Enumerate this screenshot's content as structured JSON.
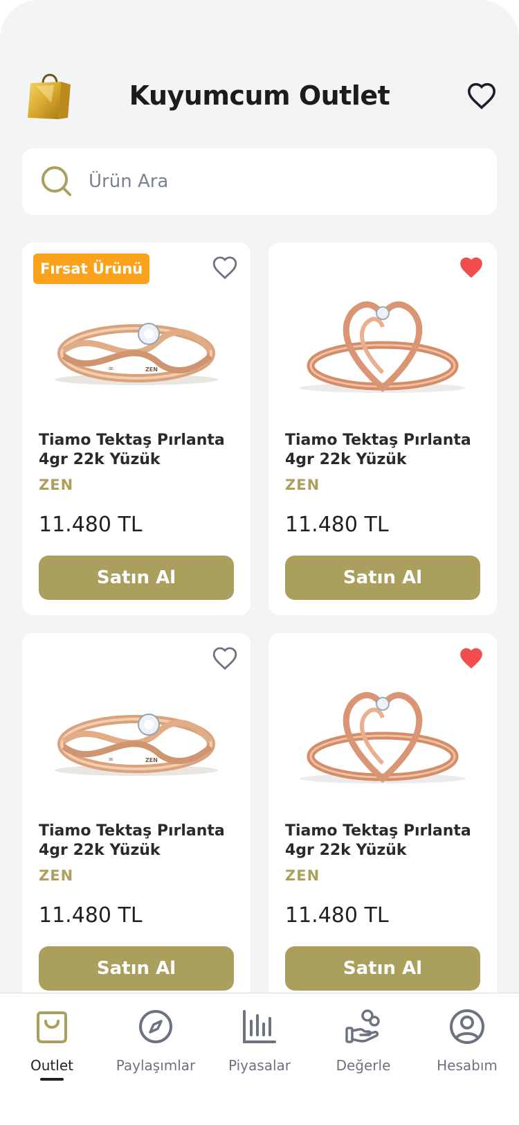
{
  "header": {
    "title": "Kuyumcum Outlet",
    "logo_icon": "shopping-bag-icon",
    "favorites_icon": "heart-icon"
  },
  "search": {
    "placeholder": "Ürün Ara",
    "icon": "search-icon"
  },
  "products": [
    {
      "badge": "Fırsat Ürünü",
      "name": "Tiamo Tektaş Pırlanta 4gr 22k Yüzük",
      "brand": "ZEN",
      "price": "11.480 TL",
      "buy_label": "Satın Al",
      "favorited": false,
      "ring": "twist"
    },
    {
      "badge": "",
      "name": "Tiamo Tektaş Pırlanta 4gr 22k Yüzük",
      "brand": "ZEN",
      "price": "11.480 TL",
      "buy_label": "Satın Al",
      "favorited": true,
      "ring": "heart"
    },
    {
      "badge": "",
      "name": "Tiamo Tektaş Pırlanta 4gr 22k Yüzük",
      "brand": "ZEN",
      "price": "11.480 TL",
      "buy_label": "Satın Al",
      "favorited": false,
      "ring": "twist"
    },
    {
      "badge": "",
      "name": "Tiamo Tektaş Pırlanta 4gr 22k Yüzük",
      "brand": "ZEN",
      "price": "11.480 TL",
      "buy_label": "Satın Al",
      "favorited": true,
      "ring": "heart"
    }
  ],
  "nav": {
    "items": [
      {
        "label": "Outlet",
        "icon": "shopping-bag-icon",
        "active": true
      },
      {
        "label": "Paylaşımlar",
        "icon": "compass-icon",
        "active": false
      },
      {
        "label": "Piyasalar",
        "icon": "bar-chart-icon",
        "active": false
      },
      {
        "label": "Değerle",
        "icon": "hand-people-icon",
        "active": false
      },
      {
        "label": "Hesabım",
        "icon": "user-circle-icon",
        "active": false
      }
    ]
  },
  "colors": {
    "accent": "#ab9f5d",
    "badge": "#fba21c",
    "favorite": "#f04e4e",
    "background": "#f3f4f6"
  }
}
